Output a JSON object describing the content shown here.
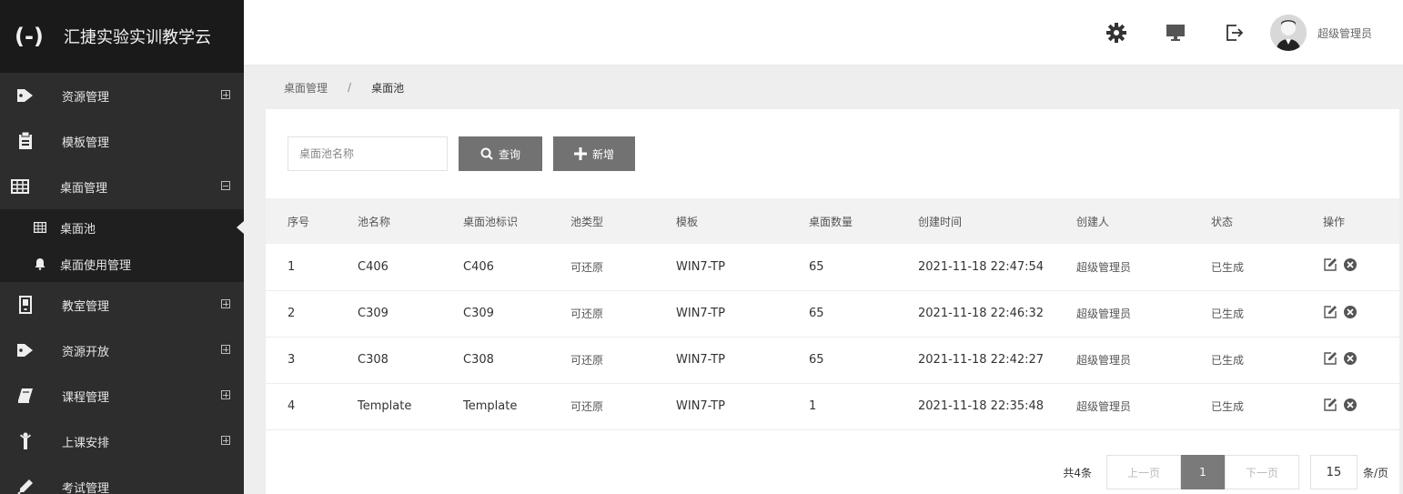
{
  "brand": {
    "logo": "(-)",
    "title": "汇捷实验实训教学云"
  },
  "sidebar": {
    "items": [
      {
        "label": "资源管理",
        "icon": "tag-icon",
        "toggle": "plus"
      },
      {
        "label": "模板管理",
        "icon": "template-icon",
        "toggle": ""
      },
      {
        "label": "桌面管理",
        "icon": "grid-icon",
        "toggle": "minus"
      },
      {
        "label": "教室管理",
        "icon": "classroom-icon",
        "toggle": "plus"
      },
      {
        "label": "资源开放",
        "icon": "tag-icon",
        "toggle": "plus"
      },
      {
        "label": "课程管理",
        "icon": "book-icon",
        "toggle": "plus"
      },
      {
        "label": "上课安排",
        "icon": "person-icon",
        "toggle": "plus"
      },
      {
        "label": "考试管理",
        "icon": "pencil-icon",
        "toggle": ""
      }
    ],
    "subitems": [
      {
        "label": "桌面池",
        "icon": "grid-icon",
        "active": true
      },
      {
        "label": "桌面使用管理",
        "icon": "bell-icon",
        "active": false
      }
    ]
  },
  "topbar": {
    "username": "超级管理员"
  },
  "breadcrumb": {
    "parent": "桌面管理",
    "separator": "/",
    "current": "桌面池"
  },
  "toolbar": {
    "search_placeholder": "桌面池名称",
    "search_label": "查询",
    "add_label": "新增"
  },
  "table": {
    "headers": [
      "序号",
      "池名称",
      "桌面池标识",
      "池类型",
      "模板",
      "桌面数量",
      "创建时间",
      "创建人",
      "状态",
      "操作"
    ],
    "rows": [
      [
        "1",
        "C406",
        "C406",
        "可还原",
        "WIN7-TP",
        "65",
        "2021-11-18 22:47:54",
        "超级管理员",
        "已生成"
      ],
      [
        "2",
        "C309",
        "C309",
        "可还原",
        "WIN7-TP",
        "65",
        "2021-11-18 22:46:32",
        "超级管理员",
        "已生成"
      ],
      [
        "3",
        "C308",
        "C308",
        "可还原",
        "WIN7-TP",
        "65",
        "2021-11-18 22:42:27",
        "超级管理员",
        "已生成"
      ],
      [
        "4",
        "Template",
        "Template",
        "可还原",
        "WIN7-TP",
        "1",
        "2021-11-18 22:35:48",
        "超级管理员",
        "已生成"
      ]
    ]
  },
  "pagination": {
    "total": "共4条",
    "prev": "上一页",
    "page": "1",
    "next": "下一页",
    "page_size": "15",
    "unit": "条/页"
  },
  "colors": {
    "sidebar_bg": "#2d2d2d",
    "brand_bg": "#1a1a1a",
    "button_bg": "#727272",
    "content_bg": "#eeeeee"
  }
}
